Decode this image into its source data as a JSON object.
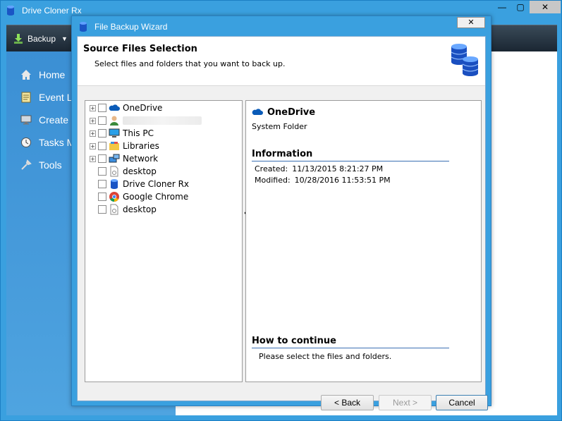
{
  "app": {
    "title": "Drive Cloner Rx",
    "toolbar": {
      "backup_label": "Backup",
      "caret": "▼"
    },
    "window_buttons": {
      "minimize": "—",
      "maximize": "▢",
      "close": "✕"
    },
    "nav": [
      {
        "label": "Home",
        "icon": "home-icon"
      },
      {
        "label": "Event Lo",
        "icon": "log-icon"
      },
      {
        "label": "Create F",
        "icon": "monitor-icon"
      },
      {
        "label": "Tasks M",
        "icon": "clock-icon"
      },
      {
        "label": "Tools",
        "icon": "tools-icon"
      }
    ]
  },
  "dialog": {
    "title": "File Backup Wizard",
    "close": "✕",
    "header": {
      "title": "Source Files Selection",
      "subtitle": "Select files and folders that you want to back up."
    },
    "tree": [
      {
        "label": "OneDrive",
        "expandable": true,
        "icon": "onedrive-icon"
      },
      {
        "label": "",
        "expandable": true,
        "icon": "user-icon",
        "blurred": true
      },
      {
        "label": "This PC",
        "expandable": true,
        "icon": "computer-icon"
      },
      {
        "label": "Libraries",
        "expandable": true,
        "icon": "libraries-icon"
      },
      {
        "label": "Network",
        "expandable": true,
        "icon": "network-icon"
      },
      {
        "label": "desktop",
        "expandable": false,
        "icon": "shortcut-file-icon"
      },
      {
        "label": "Drive Cloner Rx",
        "expandable": false,
        "icon": "database-icon"
      },
      {
        "label": "Google Chrome",
        "expandable": false,
        "icon": "chrome-icon"
      },
      {
        "label": "desktop",
        "expandable": false,
        "icon": "shortcut-file-icon"
      }
    ],
    "info": {
      "name": "OneDrive",
      "type": "System Folder",
      "information_heading": "Information",
      "created_label": "Created:",
      "created_value": "11/13/2015 8:21:27 PM",
      "modified_label": "Modified:",
      "modified_value": "10/28/2016 11:53:51 PM",
      "continue_heading": "How to continue",
      "continue_text": "Please select the files and folders."
    },
    "buttons": {
      "back": "< Back",
      "next": "Next >",
      "cancel": "Cancel"
    }
  },
  "colors": {
    "accent": "#3aa0df",
    "toolbar": "#1e2a36",
    "nav": "#4a9ede",
    "heading_rule": "#3b6fb3"
  }
}
